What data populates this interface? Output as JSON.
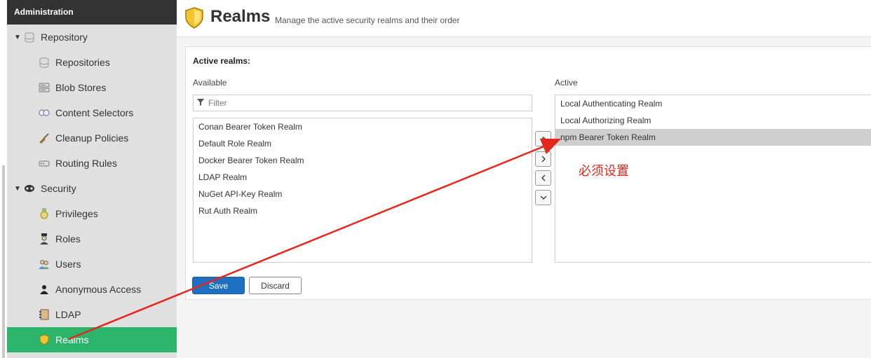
{
  "sidebar": {
    "header": "Administration",
    "groups": [
      {
        "label": "Repository",
        "items": [
          {
            "label": "Repositories"
          },
          {
            "label": "Blob Stores"
          },
          {
            "label": "Content Selectors"
          },
          {
            "label": "Cleanup Policies"
          },
          {
            "label": "Routing Rules"
          }
        ]
      },
      {
        "label": "Security",
        "items": [
          {
            "label": "Privileges"
          },
          {
            "label": "Roles"
          },
          {
            "label": "Users"
          },
          {
            "label": "Anonymous Access"
          },
          {
            "label": "LDAP"
          },
          {
            "label": "Realms"
          }
        ]
      }
    ],
    "selected_item": "Realms"
  },
  "page": {
    "title": "Realms",
    "subtitle": "Manage the active security realms and their order"
  },
  "realms": {
    "section_label": "Active realms:",
    "available_label": "Available",
    "active_label": "Active",
    "filter_placeholder": "Filter",
    "available": [
      "Conan Bearer Token Realm",
      "Default Role Realm",
      "Docker Bearer Token Realm",
      "LDAP Realm",
      "NuGet API-Key Realm",
      "Rut Auth Realm"
    ],
    "active": [
      "Local Authenticating Realm",
      "Local Authorizing Realm",
      "npm Bearer Token Realm"
    ],
    "selected_active": "npm Bearer Token Realm"
  },
  "buttons": {
    "save": "Save",
    "discard": "Discard"
  },
  "annotation": {
    "text": "必须设置",
    "color": "#e4261c"
  },
  "colors": {
    "selected_nav": "#2cb56a",
    "primary_button": "#1e6fbf",
    "sidebar_header": "#333333"
  }
}
